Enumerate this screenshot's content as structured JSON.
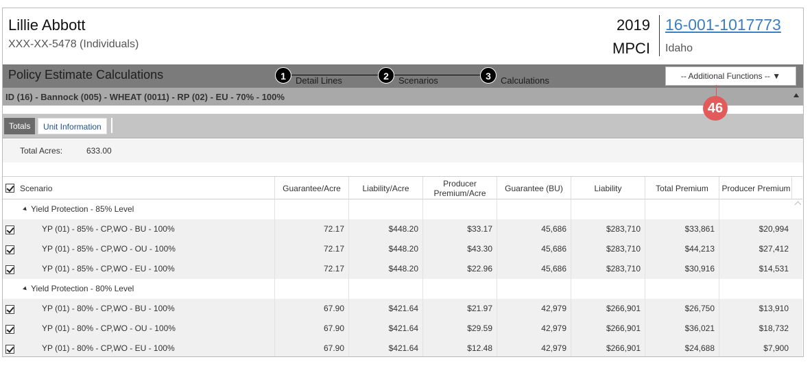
{
  "header": {
    "name": "Lillie Abbott",
    "ssn": "XXX-XX-5478 (Individuals)",
    "year": "2019",
    "program": "MPCI",
    "policy_number": "16-001-1017773",
    "state": "Idaho"
  },
  "titlebar": {
    "title": "Policy Estimate Calculations",
    "steps": [
      {
        "number": "1",
        "label": "Detail Lines"
      },
      {
        "number": "2",
        "label": "Scenarios"
      },
      {
        "number": "3",
        "label": "Calculations"
      }
    ],
    "additional_functions": "-- Additional Functions -- ▼"
  },
  "policy_line": "ID (16) - Bannock (005) - WHEAT (0011) - RP (02) - EU - 70% - 100%",
  "callout": "46",
  "tabs": {
    "totals": "Totals",
    "unit_information": "Unit Information"
  },
  "acres": {
    "label": "Total Acres:",
    "value": "633.00"
  },
  "grid": {
    "columns": [
      "Scenario",
      "Guarantee/Acre",
      "Liability/Acre",
      "Producer Premium/Acre",
      "Guarantee (BU)",
      "Liability",
      "Total Premium",
      "Producer Premium"
    ],
    "groups": [
      {
        "label": "Yield Protection - 85% Level",
        "rows": [
          {
            "scenario": "YP (01) - 85% - CP,WO - BU - 100%",
            "guarantee_acre": "72.17",
            "liability_acre": "$448.20",
            "producer_premium_acre": "$33.17",
            "guarantee_bu": "45,686",
            "liability": "$283,710",
            "total_premium": "$33,861",
            "producer_premium": "$20,994"
          },
          {
            "scenario": "YP (01) - 85% - CP,WO - OU - 100%",
            "guarantee_acre": "72.17",
            "liability_acre": "$448.20",
            "producer_premium_acre": "$43.30",
            "guarantee_bu": "45,686",
            "liability": "$283,710",
            "total_premium": "$44,213",
            "producer_premium": "$27,412"
          },
          {
            "scenario": "YP (01) - 85% - CP,WO - EU - 100%",
            "guarantee_acre": "72.17",
            "liability_acre": "$448.20",
            "producer_premium_acre": "$22.96",
            "guarantee_bu": "45,686",
            "liability": "$283,710",
            "total_premium": "$30,916",
            "producer_premium": "$14,531"
          }
        ]
      },
      {
        "label": "Yield Protection - 80% Level",
        "rows": [
          {
            "scenario": "YP (01) - 80% - CP,WO - BU - 100%",
            "guarantee_acre": "67.90",
            "liability_acre": "$421.64",
            "producer_premium_acre": "$21.97",
            "guarantee_bu": "42,979",
            "liability": "$266,901",
            "total_premium": "$26,750",
            "producer_premium": "$13,910"
          },
          {
            "scenario": "YP (01) - 80% - CP,WO - OU - 100%",
            "guarantee_acre": "67.90",
            "liability_acre": "$421.64",
            "producer_premium_acre": "$29.59",
            "guarantee_bu": "42,979",
            "liability": "$266,901",
            "total_premium": "$36,021",
            "producer_premium": "$18,732"
          },
          {
            "scenario": "YP (01) - 80% - CP,WO - EU - 100%",
            "guarantee_acre": "67.90",
            "liability_acre": "$421.64",
            "producer_premium_acre": "$12.48",
            "guarantee_bu": "42,979",
            "liability": "$266,901",
            "total_premium": "$24,688",
            "producer_premium": "$7,900"
          }
        ]
      }
    ]
  }
}
